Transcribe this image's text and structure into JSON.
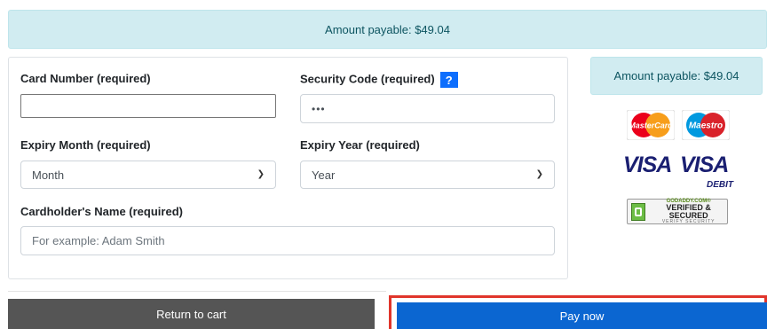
{
  "top_banner": {
    "text": "Amount payable: $49.04"
  },
  "form": {
    "card_number": {
      "label": "Card Number (required)",
      "value": ""
    },
    "security_code": {
      "label": "Security Code (required)",
      "help": "?",
      "value": "•••"
    },
    "expiry_month": {
      "label": "Expiry Month (required)",
      "selected": "Month"
    },
    "expiry_year": {
      "label": "Expiry Year (required)",
      "selected": "Year"
    },
    "cardholder_name": {
      "label": "Cardholder's Name (required)",
      "placeholder": "For example: Adam Smith"
    }
  },
  "sidebar": {
    "amount_text": "Amount payable: $49.04",
    "logos": {
      "mastercard": "MasterCard",
      "maestro": "Maestro",
      "visa": "VISA",
      "visa_debit": "VISA",
      "debit": "DEBIT",
      "godaddy_line1": "GODADDY.COM®",
      "godaddy_line2": "VERIFIED & SECURED",
      "godaddy_line3": "VERIFY SECURITY"
    }
  },
  "actions": {
    "return_label": "Return to cart",
    "pay_label": "Pay now"
  },
  "colors": {
    "info_bg": "#d1ecf1",
    "info_text": "#0c5460",
    "return_bg": "#555555",
    "pay_bg": "#0b66d1",
    "highlight": "#e0352b",
    "visa_blue": "#1a1f71"
  }
}
